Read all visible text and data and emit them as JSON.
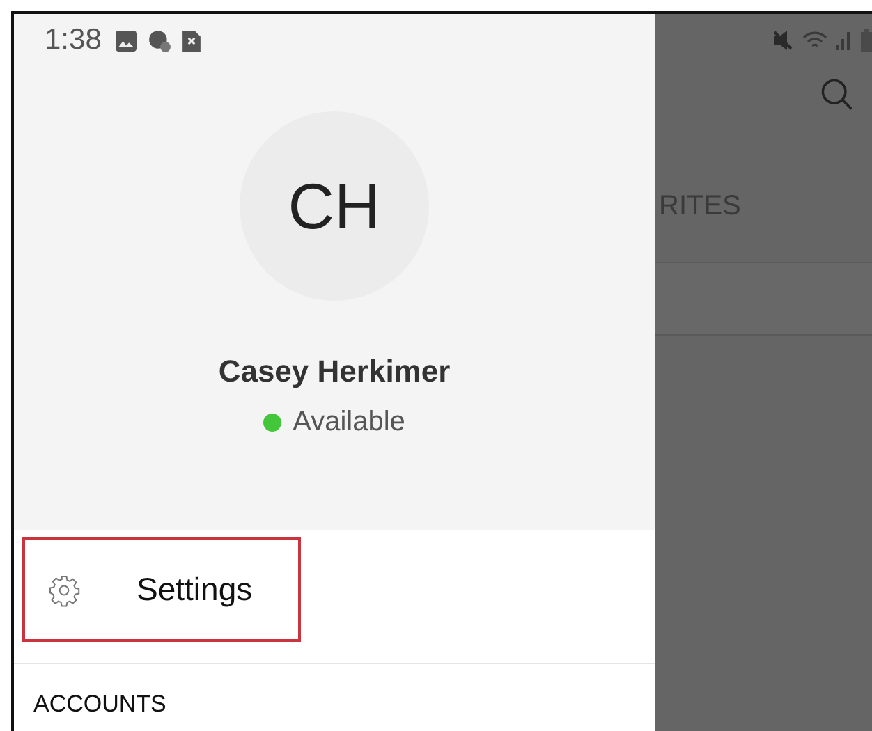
{
  "status_bar": {
    "time": "1:38"
  },
  "profile": {
    "initials": "CH",
    "name": "Casey Herkimer",
    "presence": {
      "label": "Available",
      "color": "#44c63a"
    }
  },
  "menu": [
    {
      "label": "Settings",
      "highlighted": true
    }
  ],
  "section_header": "ACCOUNTS",
  "background": {
    "tab_label": "RITES"
  }
}
